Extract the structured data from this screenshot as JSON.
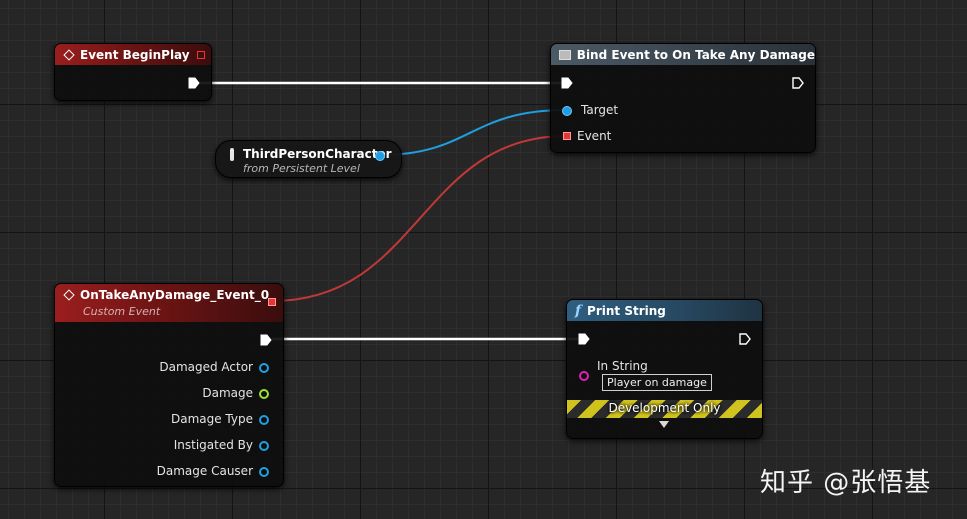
{
  "nodes": {
    "begin_play": {
      "title": "Event BeginPlay"
    },
    "bind_event": {
      "title": "Bind Event to On Take Any Damage",
      "pin_target": "Target",
      "pin_event": "Event"
    },
    "third_person": {
      "title": "ThirdPersonCharacter",
      "subtitle": "from Persistent Level"
    },
    "custom_event": {
      "title": "OnTakeAnyDamage_Event_0",
      "subtitle": "Custom Event",
      "outputs": [
        "Damaged Actor",
        "Damage",
        "Damage Type",
        "Instigated By",
        "Damage Causer"
      ]
    },
    "print_string": {
      "title": "Print String",
      "pin_in_string": "In String",
      "in_string_value": "Player on damage",
      "dev_label": "Development Only"
    }
  },
  "watermark": "知乎 @张悟基",
  "colors": {
    "exec_wire": "#ffffff",
    "object_wire": "#1f9fe0",
    "delegate_wire": "#d23c3c",
    "float_pin": "#9ae03a",
    "string_pin": "#e01fb4",
    "event_header": "#9b1e1e",
    "function_header": "#2f5e80"
  }
}
